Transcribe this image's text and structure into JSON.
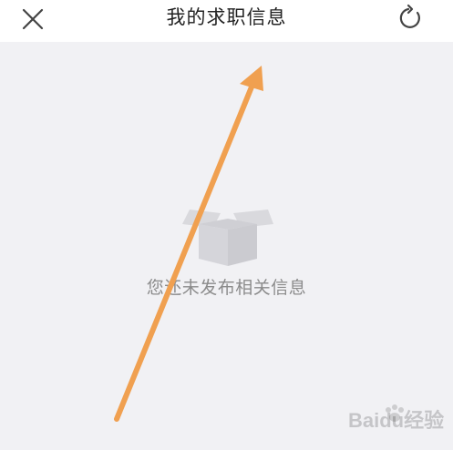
{
  "header": {
    "title": "我的求职信息",
    "close_icon": "close-icon",
    "refresh_icon": "refresh-icon"
  },
  "main": {
    "empty_icon": "empty-box-icon",
    "empty_message": "您还未发布相关信息"
  },
  "annotation": {
    "type": "arrow",
    "color": "#f0a050"
  },
  "watermark": {
    "text": "Baidu经验"
  },
  "colors": {
    "header_bg": "#ffffff",
    "content_bg": "#f1f1f4",
    "title_text": "#222222",
    "muted_text": "#8b8b8b",
    "arrow": "#f0a050"
  }
}
